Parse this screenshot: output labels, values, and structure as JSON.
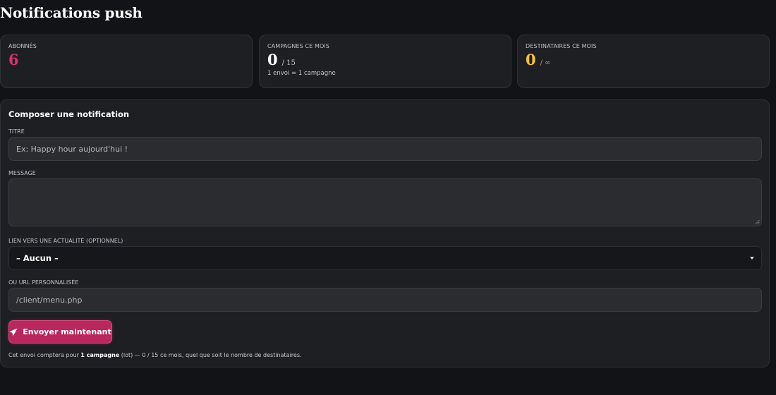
{
  "page": {
    "title": "Notifications push"
  },
  "stats": [
    {
      "label": "ABONNÉS",
      "value": "6",
      "suffix": "",
      "note": "",
      "color": "#d6336c"
    },
    {
      "label": "CAMPAGNES CE MOIS",
      "value": "0",
      "suffix": "/ 15",
      "note": "1 envoi = 1 campagne",
      "color": "#ffffff"
    },
    {
      "label": "DESTINATAIRES CE MOIS",
      "value": "0",
      "suffix": "/ ∞",
      "note": "",
      "color": "#f5c242"
    }
  ],
  "compose": {
    "title": "Composer une notification",
    "titre_label": "TITRE",
    "titre_placeholder": "Ex: Happy hour aujourd'hui !",
    "message_label": "MESSAGE",
    "message_value": "",
    "link_label": "LIEN VERS UNE ACTUALITÉ (OPTIONNEL)",
    "link_selected": "– Aucun –",
    "url_label": "OU URL PERSONNALISÉE",
    "url_placeholder": "/client/menu.php",
    "send_label": "Envoyer maintenant",
    "send_icon": "paper-plane-icon",
    "footnote_pre": "Cet envoi comptera pour ",
    "footnote_bold": "1 campagne",
    "footnote_post": " (lot) — 0 / 15 ce mois, quel que soit le nombre de destinataires."
  },
  "colors": {
    "background": "#111316",
    "card": "#1d1f23",
    "accent": "#b8275d",
    "subscribers": "#d6336c",
    "recipients": "#f5c242"
  }
}
